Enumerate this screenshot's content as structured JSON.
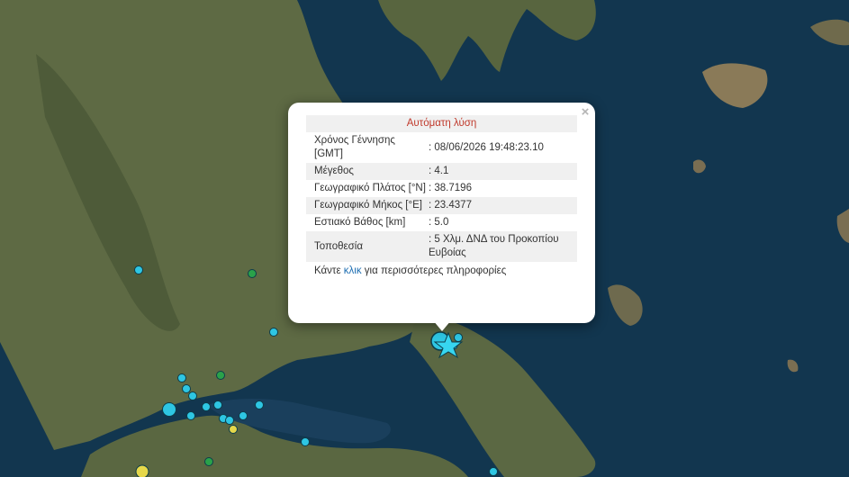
{
  "map": {
    "water_color": "#12364f",
    "land_color": "#5e6a44",
    "marker_colors": {
      "cyan": "#2ec6e3",
      "green": "#2aa24a",
      "yellow": "#e6d84a"
    },
    "epicenter_icon": "star-icon"
  },
  "popup": {
    "header": "Αυτόματη λύση",
    "close_symbol": "×",
    "rows": [
      {
        "label": "Χρόνος Γέννησης [GMT]",
        "value": ": 08/06/2026 19:48:23.10"
      },
      {
        "label": "Μέγεθος",
        "value": ": 4.1"
      },
      {
        "label": "Γεωγραφικό Πλάτος [°N]",
        "value": ": 38.7196"
      },
      {
        "label": "Γεωγραφικό Μήκος [°E]",
        "value": ": 23.4377"
      },
      {
        "label": "Εστιακό Βάθος [km]",
        "value": ": 5.0"
      },
      {
        "label": "Τοποθεσία",
        "value": ": 5 Χλμ. ΔΝΔ του Προκοπίου Ευβοίας"
      }
    ],
    "more_prefix": "Κάντε ",
    "more_link": "κλικ",
    "more_suffix": " για περισσότερες πληροφορίες"
  }
}
